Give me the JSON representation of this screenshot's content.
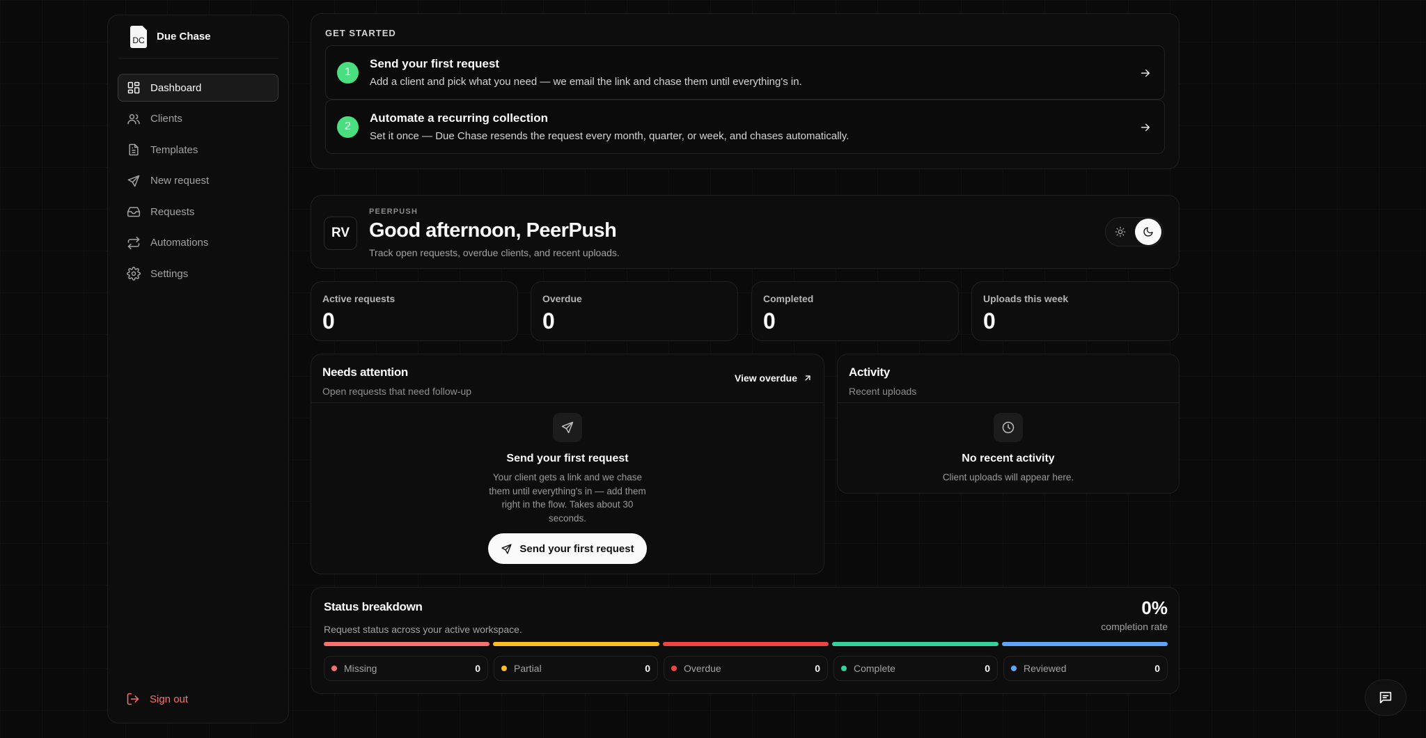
{
  "brand": {
    "logo_text": "DC",
    "name": "Due Chase"
  },
  "sidebar": {
    "items": [
      {
        "label": "Dashboard",
        "icon": "dashboard-icon",
        "active": true
      },
      {
        "label": "Clients",
        "icon": "users-icon"
      },
      {
        "label": "Templates",
        "icon": "file-text-icon"
      },
      {
        "label": "New request",
        "icon": "send-icon"
      },
      {
        "label": "Requests",
        "icon": "inbox-icon"
      },
      {
        "label": "Automations",
        "icon": "repeat-icon"
      },
      {
        "label": "Settings",
        "icon": "gear-icon"
      }
    ],
    "signout_label": "Sign out"
  },
  "get_started": {
    "title": "GET STARTED",
    "steps": [
      {
        "number": "1",
        "title": "Send your first request",
        "desc": "Add a client and pick what you need — we email the link and chase them until everything's in."
      },
      {
        "number": "2",
        "title": "Automate a recurring collection",
        "desc": "Set it once — Due Chase resends the request every month, quarter, or week, and chases automatically."
      }
    ]
  },
  "greeting": {
    "avatar": "RV",
    "org": "PEERPUSH",
    "title": "Good afternoon, PeerPush",
    "subtitle": "Track open requests, overdue clients, and recent uploads.",
    "theme": "dark"
  },
  "stats": [
    {
      "label": "Active requests",
      "value": "0"
    },
    {
      "label": "Overdue",
      "value": "0"
    },
    {
      "label": "Completed",
      "value": "0"
    },
    {
      "label": "Uploads this week",
      "value": "0"
    }
  ],
  "needs_attention": {
    "title": "Needs attention",
    "subtitle": "Open requests that need follow-up",
    "link_label": "View overdue",
    "empty_title": "Send your first request",
    "empty_desc": "Your client gets a link and we chase them until everything's in — add them right in the flow. Takes about 30 seconds.",
    "cta_label": "Send your first request"
  },
  "activity": {
    "title": "Activity",
    "subtitle": "Recent uploads",
    "empty_title": "No recent activity",
    "empty_desc": "Client uploads will appear here."
  },
  "status_breakdown": {
    "title": "Status breakdown",
    "subtitle": "Request status across your active workspace.",
    "completion": "0%",
    "completion_label": "completion rate",
    "statuses": [
      {
        "label": "Missing",
        "count": "0",
        "color": "#f87171"
      },
      {
        "label": "Partial",
        "count": "0",
        "color": "#fbbf24"
      },
      {
        "label": "Overdue",
        "count": "0",
        "color": "#ef4444"
      },
      {
        "label": "Complete",
        "count": "0",
        "color": "#34d399"
      },
      {
        "label": "Reviewed",
        "count": "0",
        "color": "#60a5fa"
      }
    ]
  }
}
